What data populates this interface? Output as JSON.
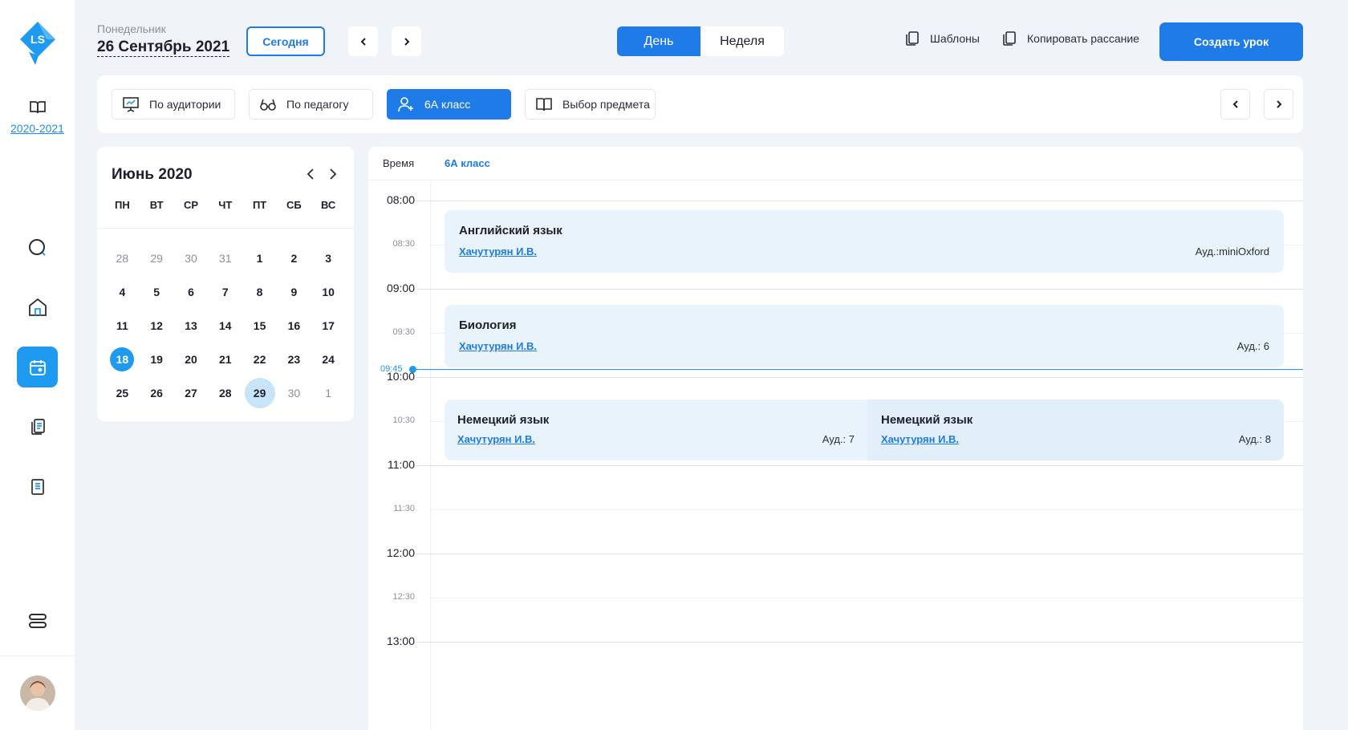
{
  "brand": {
    "logo_text": "LS"
  },
  "sidebar": {
    "year": "2020-2021",
    "items": [
      {
        "icon": "search-icon"
      },
      {
        "icon": "home-icon"
      },
      {
        "icon": "calendar-icon",
        "active": true
      },
      {
        "icon": "copy-icon"
      },
      {
        "icon": "document-icon"
      },
      {
        "icon": "storage-icon"
      }
    ]
  },
  "header": {
    "day_of_week": "Понедельник",
    "date": "26 Сентябрь 2021",
    "today_label": "Сегодня",
    "view_day": "День",
    "view_week": "Неделя",
    "templates_label": "Шаблоны",
    "copy_schedule_label": "Копировать рассание",
    "create_lesson_label": "Создать урок"
  },
  "filters": {
    "by_room": "По аудитории",
    "by_teacher": "По педагогу",
    "by_class": "6А класс",
    "by_subject": "Выбор предмета"
  },
  "calendar": {
    "title": "Июнь 2020",
    "weekdays": [
      "ПН",
      "ВТ",
      "СР",
      "ЧТ",
      "ПТ",
      "СБ",
      "ВС"
    ],
    "days": [
      [
        "28",
        "other"
      ],
      [
        "29",
        "other"
      ],
      [
        "30",
        "other"
      ],
      [
        "31",
        "other"
      ],
      [
        "1",
        ""
      ],
      [
        "2",
        ""
      ],
      [
        "3",
        ""
      ],
      [
        "4",
        ""
      ],
      [
        "5",
        ""
      ],
      [
        "6",
        ""
      ],
      [
        "7",
        ""
      ],
      [
        "8",
        ""
      ],
      [
        "9",
        ""
      ],
      [
        "10",
        ""
      ],
      [
        "11",
        ""
      ],
      [
        "12",
        ""
      ],
      [
        "13",
        ""
      ],
      [
        "14",
        ""
      ],
      [
        "15",
        ""
      ],
      [
        "16",
        ""
      ],
      [
        "17",
        ""
      ],
      [
        "18",
        "today"
      ],
      [
        "19",
        ""
      ],
      [
        "20",
        ""
      ],
      [
        "21",
        ""
      ],
      [
        "22",
        ""
      ],
      [
        "23",
        ""
      ],
      [
        "24",
        ""
      ],
      [
        "25",
        ""
      ],
      [
        "26",
        ""
      ],
      [
        "27",
        ""
      ],
      [
        "28",
        ""
      ],
      [
        "29",
        "sel"
      ],
      [
        "30",
        "other"
      ],
      [
        "1",
        "other"
      ]
    ]
  },
  "schedule": {
    "time_header": "Время",
    "class_header": "6А класс",
    "times": [
      "08:00",
      "08:30",
      "09:00",
      "09:30",
      "10:00",
      "10:30",
      "11:00",
      "11:30",
      "12:00",
      "12:30",
      "13:00"
    ],
    "now_label": "09:45",
    "lessons": [
      {
        "title": "Английский язык",
        "teacher": "Хачутурян И.В.",
        "room": "Ауд.:miniOxford"
      },
      {
        "title": "Биология",
        "teacher": "Хачутурян И.В.",
        "room": "Ауд.: 6"
      },
      {
        "title": "Немецкий язык",
        "teacher": "Хачутурян И.В.",
        "room": "Ауд.: 7"
      },
      {
        "title": "Немецкий язык",
        "teacher": "Хачутурян И.В.",
        "room": "Ауд.: 8"
      }
    ]
  },
  "colors": {
    "accent": "#1e7be8",
    "accent_light": "#1e9bf0",
    "lesson_bg": "#e9f3fc",
    "page_bg": "#f0f3f8"
  }
}
